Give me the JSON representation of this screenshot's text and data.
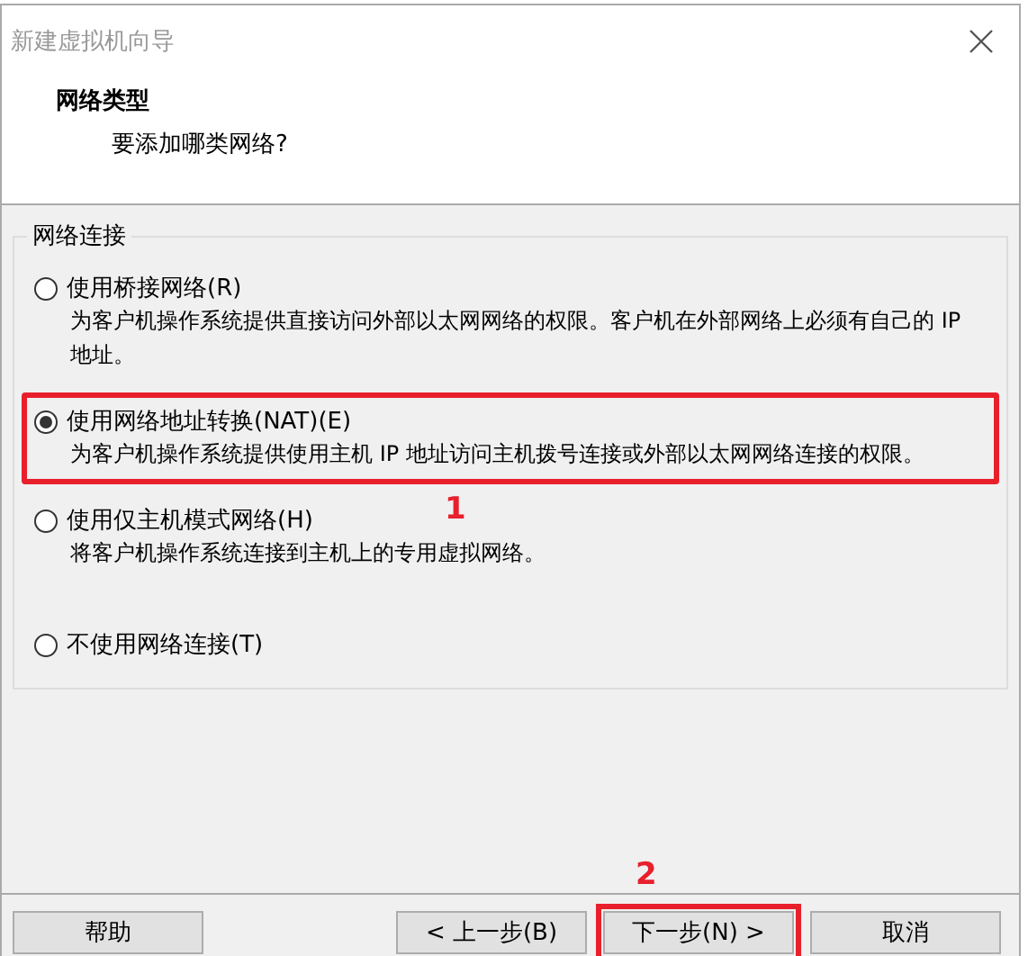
{
  "window": {
    "title": "新建虚拟机向导"
  },
  "header": {
    "title": "网络类型",
    "subtitle": "要添加哪类网络?"
  },
  "group": {
    "title": "网络连接",
    "options": [
      {
        "label": "使用桥接网络(R)",
        "description": "为客户机操作系统提供直接访问外部以太网网络的权限。客户机在外部网络上必须有自己的 IP 地址。",
        "selected": false,
        "highlighted": false
      },
      {
        "label": "使用网络地址转换(NAT)(E)",
        "description": "为客户机操作系统提供使用主机 IP 地址访问主机拨号连接或外部以太网网络连接的权限。",
        "selected": true,
        "highlighted": true
      },
      {
        "label": "使用仅主机模式网络(H)",
        "description": "将客户机操作系统连接到主机上的专用虚拟网络。",
        "selected": false,
        "highlighted": false
      },
      {
        "label": "不使用网络连接(T)",
        "selected": false,
        "highlighted": false
      }
    ]
  },
  "annotations": [
    "1",
    "2"
  ],
  "buttons": [
    {
      "label": "帮助",
      "highlighted": false
    },
    {
      "label": "< 上一步(B)",
      "highlighted": false
    },
    {
      "label": "下一步(N) >",
      "highlighted": true
    },
    {
      "label": "取消",
      "highlighted": false
    }
  ]
}
